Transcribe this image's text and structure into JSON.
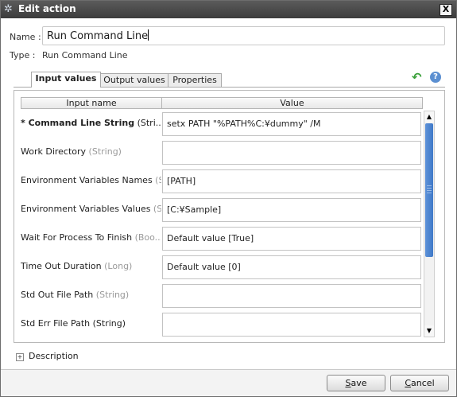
{
  "window": {
    "title": "Edit action",
    "close_glyph": "X"
  },
  "form": {
    "name_label": "Name :",
    "name_value": "Run Command Line",
    "type_label": "Type :",
    "type_value": "Run Command Line"
  },
  "tabs": [
    {
      "label": "Input values",
      "active": true
    },
    {
      "label": "Output values",
      "active": false
    },
    {
      "label": "Properties",
      "active": false
    }
  ],
  "grid": {
    "col_name": "Input name",
    "col_value": "Value",
    "rows": [
      {
        "marker": "* ",
        "name": "Command Line String",
        "type": " (Stri...",
        "value": "setx PATH \"%PATH%C:¥dummy\" /M"
      },
      {
        "marker": "",
        "name": "Work Directory",
        "type": " (String)",
        "value": ""
      },
      {
        "marker": "",
        "name": "Environment Variables Names",
        "type": " (S...",
        "value": "[PATH]"
      },
      {
        "marker": "",
        "name": "Environment Variables Values",
        "type": " (S...",
        "value": "[C:¥Sample]"
      },
      {
        "marker": "",
        "name": "Wait For Process To Finish",
        "type": " (Boo...",
        "value": "Default value [True]"
      },
      {
        "marker": "",
        "name": "Time Out Duration",
        "type": " (Long)",
        "value": "Default value [0]"
      },
      {
        "marker": "",
        "name": "Std Out File Path",
        "type": " (String)",
        "value": ""
      },
      {
        "marker": "",
        "name": "Std Err File Path (String)",
        "type": "",
        "value": ""
      }
    ]
  },
  "description_label": "Description",
  "buttons": {
    "save_mnemonic": "S",
    "save_rest": "ave",
    "cancel_mnemonic": "C",
    "cancel_rest": "ancel"
  },
  "icons": {
    "title": "gear-icon",
    "back": "back-arrow-icon",
    "help": "help-icon",
    "expand": "expand-plus-icon",
    "scroll_up": "scroll-up-arrow-icon",
    "scroll_down": "scroll-down-arrow-icon"
  },
  "colors": {
    "titlebar": "#4a4a4a",
    "scroll_thumb": "#4a80cc",
    "back_icon": "#3aa03a",
    "help_icon": "#5b8fd1"
  }
}
